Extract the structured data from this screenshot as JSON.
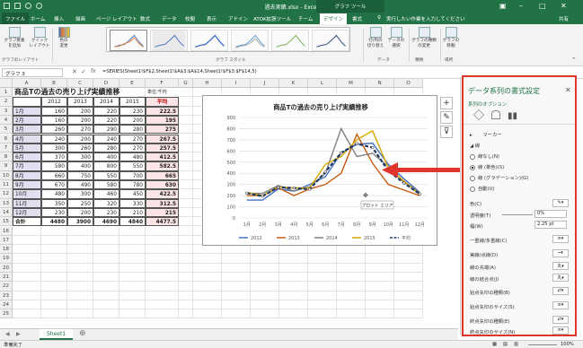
{
  "window": {
    "title": "過去実績.xlsx - Excel",
    "context_tab": "グラフ ツール"
  },
  "ribbon_tabs": [
    "ファイル",
    "ホーム",
    "挿入",
    "描画",
    "ページ レイアウト",
    "数式",
    "データ",
    "校閲",
    "表示",
    "アドイン",
    "ATOK拡張ツール",
    "チーム",
    "デザイン",
    "書式"
  ],
  "search_label": "実行したい作業を入力してください",
  "user_label": "共有",
  "ribbon": {
    "add_element": "グラフ要素\nを追加",
    "quick_layout": "クイック\nレイアウト",
    "change_color": "色の\n変更",
    "switch_row_col": "行/列の\n切り替え",
    "select_data": "データの\n選択",
    "change_type": "グラフの種類\nの変更",
    "move_chart": "グラフの\n移動",
    "group_layouts": "グラフのレイアウト",
    "group_styles": "グラフ スタイル",
    "group_data": "データ",
    "group_type": "種類",
    "group_location": "場所"
  },
  "name_box": "グラフ 3",
  "formula": "=SERIES(Sheet1!$F$2,Sheet1!$A$3:$A$14,Sheet1!$F$3:$F$14,5)",
  "columns": [
    "A",
    "B",
    "C",
    "D",
    "E",
    "F",
    "G",
    "H",
    "I",
    "J",
    "K",
    "L",
    "M",
    "N",
    "O"
  ],
  "rows": [
    "1",
    "2",
    "3",
    "4",
    "5",
    "6",
    "7",
    "8",
    "9",
    "10",
    "11",
    "12",
    "13",
    "14",
    "15",
    "16",
    "17",
    "18",
    "19",
    "20",
    "21",
    "22",
    "23",
    "24",
    "25"
  ],
  "sheet": {
    "title": "商品Tの過去の売り上げ実績推移",
    "unit": "単位:千円",
    "headers": [
      "",
      "2012",
      "2013",
      "2014",
      "2015",
      "平均"
    ],
    "data": [
      [
        "1月",
        "160",
        "200",
        "220",
        "230",
        "222.5"
      ],
      [
        "2月",
        "160",
        "200",
        "220",
        "200",
        "195"
      ],
      [
        "3月",
        "260",
        "270",
        "290",
        "280",
        "275"
      ],
      [
        "4月",
        "240",
        "200",
        "240",
        "270",
        "267.5"
      ],
      [
        "5月",
        "300",
        "260",
        "280",
        "270",
        "257.5"
      ],
      [
        "6月",
        "370",
        "300",
        "400",
        "480",
        "412.5"
      ],
      [
        "7月",
        "580",
        "400",
        "800",
        "550",
        "582.5"
      ],
      [
        "8月",
        "660",
        "750",
        "550",
        "700",
        "665"
      ],
      [
        "9月",
        "670",
        "490",
        "580",
        "780",
        "630"
      ],
      [
        "10月",
        "480",
        "300",
        "460",
        "450",
        "422.5"
      ],
      [
        "11月",
        "350",
        "250",
        "320",
        "330",
        "312.5"
      ],
      [
        "12月",
        "230",
        "200",
        "230",
        "210",
        "215"
      ]
    ],
    "total": [
      "合計",
      "4480",
      "3900",
      "4690",
      "4840",
      "4477.5"
    ]
  },
  "chart_data": {
    "type": "line",
    "title": "商品Tの過去の売り上げ実績推移",
    "categories": [
      "1月",
      "2月",
      "3月",
      "4月",
      "5月",
      "6月",
      "7月",
      "8月",
      "9月",
      "10月",
      "11月",
      "12月"
    ],
    "ylim": [
      0,
      900
    ],
    "yticks": [
      "0",
      "100",
      "200",
      "300",
      "400",
      "500",
      "600",
      "700",
      "800",
      "900"
    ],
    "series": [
      {
        "name": "2012",
        "color": "#4472c4",
        "values": [
          160,
          160,
          260,
          240,
          300,
          370,
          580,
          660,
          670,
          480,
          350,
          230
        ]
      },
      {
        "name": "2013",
        "color": "#c55a11",
        "values": [
          200,
          200,
          270,
          200,
          260,
          300,
          400,
          750,
          490,
          300,
          250,
          200
        ]
      },
      {
        "name": "2014",
        "color": "#7f7f7f",
        "values": [
          220,
          220,
          290,
          240,
          280,
          400,
          800,
          550,
          580,
          460,
          320,
          230
        ]
      },
      {
        "name": "2015",
        "color": "#d6a800",
        "values": [
          230,
          200,
          280,
          270,
          270,
          480,
          550,
          700,
          780,
          450,
          330,
          210
        ]
      },
      {
        "name": "平均",
        "color": "#203864",
        "values": [
          222.5,
          195,
          275,
          267.5,
          257.5,
          412.5,
          582.5,
          665,
          630,
          422.5,
          312.5,
          215
        ]
      }
    ],
    "tooltip": "プロット エリア",
    "legend_position": "bottom"
  },
  "chart_tools": {
    "plus": "+",
    "brush": "✎",
    "filter": "⊽"
  },
  "pane": {
    "title": "データ系列の書式設定",
    "options_label": "系列のオプション",
    "section_marker": "マーカー",
    "section_line": "線",
    "line_none": "線なし(N)",
    "line_solid": "線 (単色)(S)",
    "line_gradient": "線 (グラデーション)(G)",
    "line_auto": "自動(U)",
    "color_label": "色(C)",
    "transparency_label": "透明度(T)",
    "transparency_value": "0%",
    "width_label": "幅(W)",
    "width_value": "2.25 pt",
    "compound_label": "一重線/多重線(C)",
    "dash_label": "実線/点線(D)",
    "cap_label": "線の先端(A)",
    "join_label": "線の結合点(J)",
    "begin_arrow_type": "始点矢印の種類(B)",
    "begin_arrow_size": "始点矢印のサイズ(S)",
    "end_arrow_type": "終点矢印の種類(E)",
    "end_arrow_size": "終点矢印のサイズ(N)"
  },
  "sheet_tab": "Sheet1",
  "status": "準備完了",
  "zoom": "100%"
}
